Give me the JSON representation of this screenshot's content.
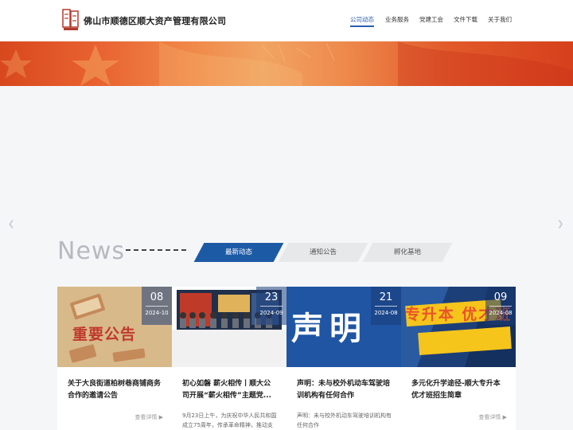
{
  "header": {
    "brand": "佛山市顺德区顺大资产管理有限公司",
    "nav": [
      "公司动态",
      "业务服务",
      "党建工会",
      "文件下载",
      "关于我们"
    ]
  },
  "news": {
    "heading": "News",
    "tabs": [
      "最新动态",
      "通知公告",
      "孵化基地"
    ]
  },
  "cards": [
    {
      "day": "08",
      "ym": "2024-10",
      "image_text": "重要公告",
      "title": "关于大良街道柏树巷商铺商务合作的邀请公告",
      "desc": "",
      "more": "查看详情 ▶"
    },
    {
      "day": "23",
      "ym": "2024-09",
      "image_text": "",
      "title": "初心如磐 薪火相传丨顺大公司开展“薪火相传”主题党...",
      "desc": "9月23日上午，为庆祝中华人民共和国成立75周年，传承革命精神，推动支",
      "more": ""
    },
    {
      "day": "21",
      "ym": "2024-08",
      "image_text": "声明",
      "title": "声明：未与校外机动车驾驶培训机构有任何合作",
      "desc": "声明：未与校外机动车驾驶培训机构有任何合作",
      "more": ""
    },
    {
      "day": "09",
      "ym": "2024-08",
      "image_text": "专升本 优才班",
      "title": "多元化升学途径-顺大专升本优才班招生简章",
      "desc": "",
      "more": "查看详情 ▶"
    }
  ],
  "colors": {
    "accent": "#2a5db0",
    "tab_active": "#1d5aa6",
    "card3_bg": "#1f55a3",
    "card4_text": "#e9522a"
  },
  "icons": [
    "company-logo-icon",
    "slider-prev-icon",
    "slider-next-icon"
  ]
}
